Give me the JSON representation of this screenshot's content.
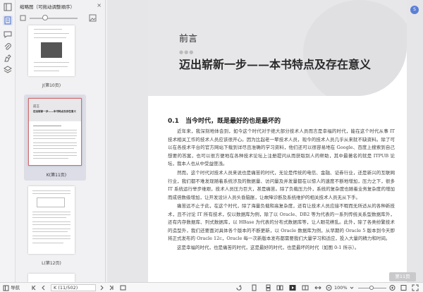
{
  "thumbnail_panel": {
    "title": "缩略图（可拖动调整顺序）",
    "close": "×",
    "pages": [
      {
        "label": "J(第10页)"
      },
      {
        "label": "K(第11页)",
        "mini_preface": "前言",
        "mini_title": "迈出崭新一步——本书特点及存在意义",
        "selected": true
      },
      {
        "label": "L(第12页)"
      }
    ]
  },
  "document": {
    "preface": "前言",
    "dots": "●●●",
    "chapter_title": "迈出崭新一步——本书特点及存在意义",
    "section_title": "0.1　当今时代，既是最好的也是最坏的",
    "paragraphs": [
      "近年来，我深刻地体会到，如今这个时代对于绝大部分技术人员而言是幸福的时代，能在这个时代从事 IT 技术相关工作的技术人员应该很开心。因为比起老一辈技术人员，现今的技术人员几乎从来就不缺资料。除了可以在各技术平台的官方网站下载到详尽且准确的学习资料，他们还可以很容易地在 Google、百度上搜索到自己想要的答案，也可以很方便地在各种技术论坛上注册提问从而获取别人的帮助，其中最著名的就是 ITPUB 论坛，我本人也从中受益匪浅。",
      "然而，这个时代对技术人员来说也是痛苦的时代，无论是传统的电信、金融、证券行业，还是新兴的互联网行业，我们都不难发现随着系统涉及的数据量、访问量及并发量都在以惊人的速度不断地增加，压力之下，很多 IT 系统运行举步维艰，技术人员压力巨大，甚是痛苦。除了负载压力外，系统的复杂度也随着业务复杂度的增加而成倍数级增加，让开发设计人员头昏脑胀，让故障诊断及系统维护的相关技术人员无从下手。",
      "痛苦远不止于此，在这个时代，除了海量负载和高复杂度，还有让技术人员应接不暇而无所适从的各种新技术，且不讨论 IT 所有技术，仅以数据库为例，除了以 Oracle、DB2 等为代表的一系列传统关系型数据库外，还有内存数据库、列式数据库，以 HBase 为代表的分布式数据库等，让人眼花缭乱。此外，除了各类纷繁技术的造型外，我们还要面对具体各个版本的不断更新，以 Oracle 数据库为例，从早期的 Oracle 5 版本到今天即将正式发布的 Oracle 12c，Oracle 每一次新版本发布都需要我们大量学习和适应，投入大量的精力和时间。",
      "这是幸福的时代，也是痛苦的时代，这是最好的时代，也是最坏的时代（如图 0-1 所示）。"
    ],
    "page_button": "第11页",
    "avatar": "S"
  },
  "bottom_bar": {
    "nav_label": "导航",
    "page_indicator": "K (11/502)",
    "zoom": "100%"
  }
}
